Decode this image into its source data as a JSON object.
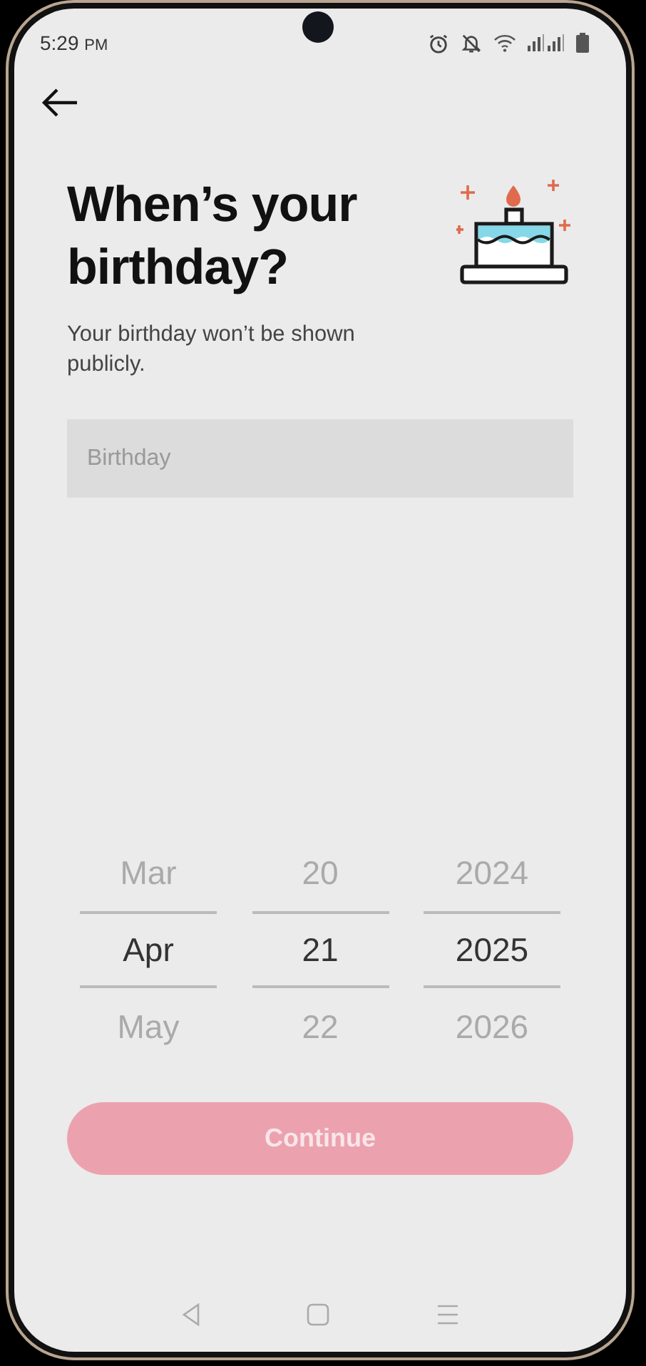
{
  "status_bar": {
    "time": "5:29",
    "meridiem": "PM"
  },
  "header": {
    "title": "When’s your birthday?",
    "subtitle": "Your birthday won’t be shown publicly."
  },
  "birthday_field": {
    "placeholder": "Birthday"
  },
  "picker": {
    "columns": [
      {
        "items": [
          {
            "label": "Mar",
            "selected": false
          },
          {
            "label": "Apr",
            "selected": true
          },
          {
            "label": "May",
            "selected": false
          }
        ]
      },
      {
        "items": [
          {
            "label": "20",
            "selected": false
          },
          {
            "label": "21",
            "selected": true
          },
          {
            "label": "22",
            "selected": false
          }
        ]
      },
      {
        "items": [
          {
            "label": "2024",
            "selected": false
          },
          {
            "label": "2025",
            "selected": true
          },
          {
            "label": "2026",
            "selected": false
          }
        ]
      }
    ]
  },
  "continue_button": {
    "label": "Continue",
    "disabled": true
  }
}
